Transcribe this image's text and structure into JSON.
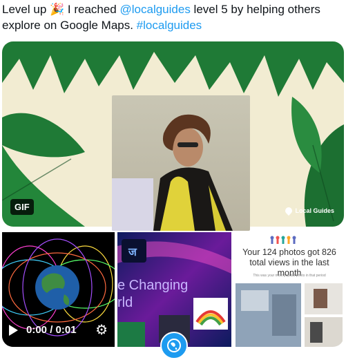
{
  "tweet": {
    "part1": "Level up 🎉 I reached ",
    "mention": "@localguides",
    "part2": " level 5 by helping others explore on Google Maps. ",
    "hashtag": "#localguides"
  },
  "gif_card": {
    "badge": "GIF",
    "watermark": "Local Guides"
  },
  "video": {
    "time": "0:00 / 0:01"
  },
  "thumb2": {
    "text_changing": "e Changing",
    "text_world": "rld"
  },
  "stats_card": {
    "title": "Your 124 photos got 826 total views in the last month",
    "subtitle": "This was your most popular photo in that period"
  },
  "icons": {
    "play": "play-icon",
    "settings": "gear-icon",
    "globe": "globe-icon",
    "pin": "pin-icon"
  },
  "colors": {
    "link": "#1d9bf0",
    "leaf": "#1a7a35",
    "cream": "#f2ecd2"
  }
}
